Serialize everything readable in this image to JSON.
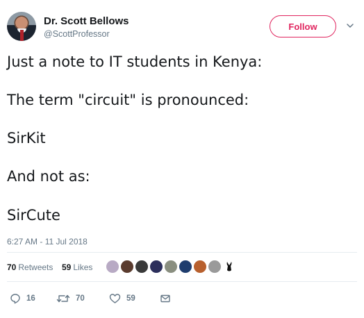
{
  "author": {
    "name": "Dr. Scott Bellows",
    "handle": "@ScottProfessor"
  },
  "follow_label": "Follow",
  "tweet": {
    "lines": [
      "Just a note to IT students in Kenya:",
      "The term \"circuit\" is pronounced:",
      "SirKit",
      "And not as:",
      "SirCute"
    ]
  },
  "timestamp": "6:27 AM - 11 Jul 2018",
  "stats": {
    "retweets_count": "70",
    "retweets_label": "Retweets",
    "likes_count": "59",
    "likes_label": "Likes"
  },
  "actions": {
    "replies": "16",
    "retweets": "70",
    "likes": "59"
  },
  "colors": {
    "accent": "#e0245e",
    "muted": "#657786",
    "text": "#14171a",
    "link_blue": "#1b95e0"
  },
  "icons": [
    "reply-icon",
    "retweet-icon",
    "like-icon",
    "message-icon",
    "caret-down-icon"
  ]
}
